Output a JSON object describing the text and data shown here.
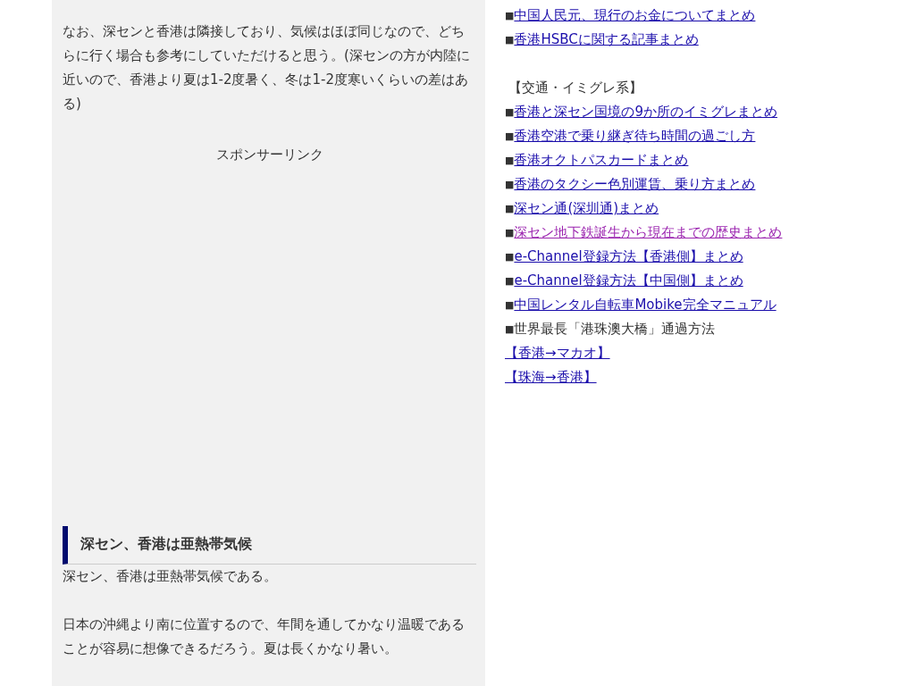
{
  "main": {
    "intro_paragraph": "なお、深センと香港は隣接しており、気候はほぼ同じなので、どちらに行く場合も参考にしていただけると思う。(深センの方が内陸に近いので、香港より夏は1-2度暑く、冬は1-2度寒いくらいの差はある)",
    "sponsor_label": "スポンサーリンク",
    "section_heading": "深セン、香港は亜熱帯気候",
    "paragraphs": [
      "深セン、香港は亜熱帯気候である。",
      "日本の沖縄より南に位置するので、年間を通してかなり温暖であることが容易に想像できるだろう。夏は長くかなり暑い。"
    ]
  },
  "sidebar": {
    "items": [
      {
        "kind": "link",
        "bullet": "■",
        "text": "中国人民元、現行のお金についてまとめ",
        "visited": false
      },
      {
        "kind": "link",
        "bullet": "■",
        "text": "香港HSBCに関する記事まとめ",
        "visited": false
      },
      {
        "kind": "heading",
        "text": "【交通・イミグレ系】"
      },
      {
        "kind": "link",
        "bullet": "■",
        "text": "香港と深セン国境の9か所のイミグレまとめ",
        "visited": false
      },
      {
        "kind": "link",
        "bullet": "■",
        "text": "香港空港で乗り継ぎ待ち時間の過ごし方",
        "visited": false
      },
      {
        "kind": "link",
        "bullet": "■",
        "text": "香港オクトパスカードまとめ",
        "visited": false
      },
      {
        "kind": "link",
        "bullet": "■",
        "text": "香港のタクシー色別運賃、乗り方まとめ",
        "visited": false
      },
      {
        "kind": "link",
        "bullet": "■",
        "text": "深セン通(深圳通)まとめ",
        "visited": false
      },
      {
        "kind": "link",
        "bullet": "■",
        "text": "深セン地下鉄誕生から現在までの歴史まとめ",
        "visited": true
      },
      {
        "kind": "link",
        "bullet": "■",
        "text": "e-Channel登録方法【香港側】まとめ",
        "visited": false
      },
      {
        "kind": "link",
        "bullet": "■",
        "text": "e-Channel登録方法【中国側】まとめ",
        "visited": false
      },
      {
        "kind": "link",
        "bullet": "■",
        "text": "中国レンタル自転車Mobike完全マニュアル",
        "visited": false
      },
      {
        "kind": "text",
        "bullet": "■",
        "text": "世界最長「港珠澳大橋」通過方法"
      },
      {
        "kind": "link",
        "text": "【香港→マカオ】",
        "visited": false
      },
      {
        "kind": "link",
        "text": "【珠海→香港】",
        "visited": false
      }
    ]
  }
}
